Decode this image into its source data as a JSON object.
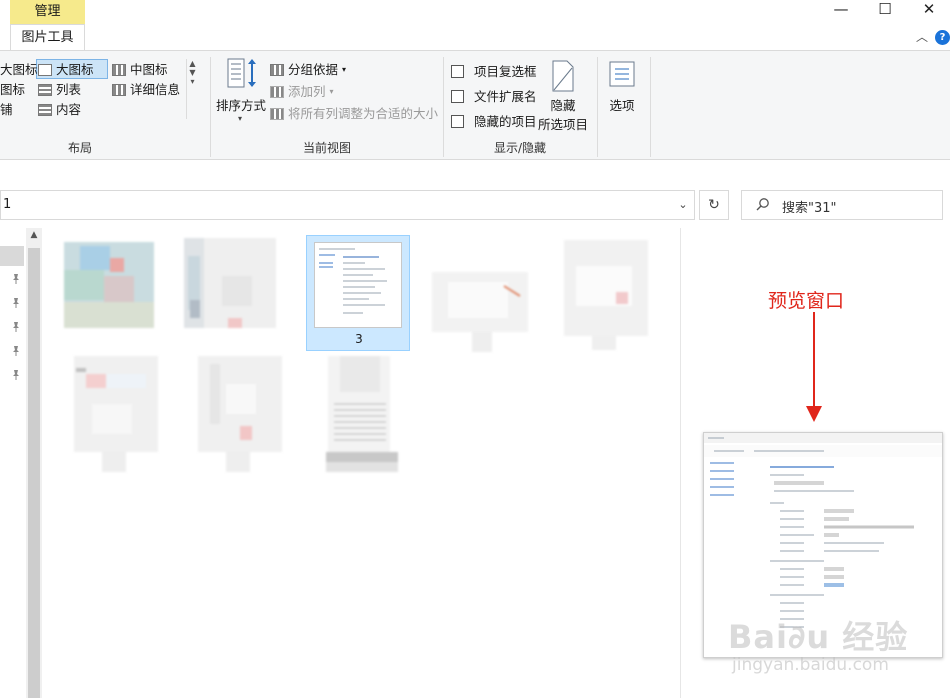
{
  "window": {
    "context_tab": "管理",
    "active_tab": "图片工具",
    "minimize_glyph": "—",
    "maximize_glyph": "☐",
    "close_glyph": "✕",
    "collapse_glyph": "︿",
    "help_glyph": "?"
  },
  "ribbon": {
    "layout": {
      "items_col1": [
        "大图标",
        "图标",
        "铺"
      ],
      "items_col2": [
        "大图标",
        "列表",
        "内容"
      ],
      "items_col3": [
        "中图标",
        "详细信息"
      ],
      "selected": "大图标",
      "label": "布局"
    },
    "current_view": {
      "sort_label": "排序方式",
      "group_by": "分组依据",
      "add_column": "添加列",
      "fit_columns": "将所有列调整为合适的大小",
      "label": "当前视图"
    },
    "show_hide": {
      "checkboxes": [
        "项目复选框",
        "文件扩展名",
        "隐藏的项目"
      ],
      "hide_selected_line1": "隐藏",
      "hide_selected_line2": "所选项目",
      "label": "显示/隐藏"
    },
    "options": {
      "label": "选项"
    }
  },
  "address": {
    "path_text": "1",
    "dropdown_glyph": "⌄",
    "refresh_glyph": "↻"
  },
  "search": {
    "icon": "search-icon",
    "placeholder": "搜索\"31\""
  },
  "files": {
    "selected_label": "3"
  },
  "preview": {
    "annotation": "预览窗口"
  },
  "colors": {
    "context_tab_bg": "#f6ea8c",
    "selection_bg": "#cce8ff",
    "annotation_red": "#e0261b",
    "help_blue": "#1a73d9"
  }
}
